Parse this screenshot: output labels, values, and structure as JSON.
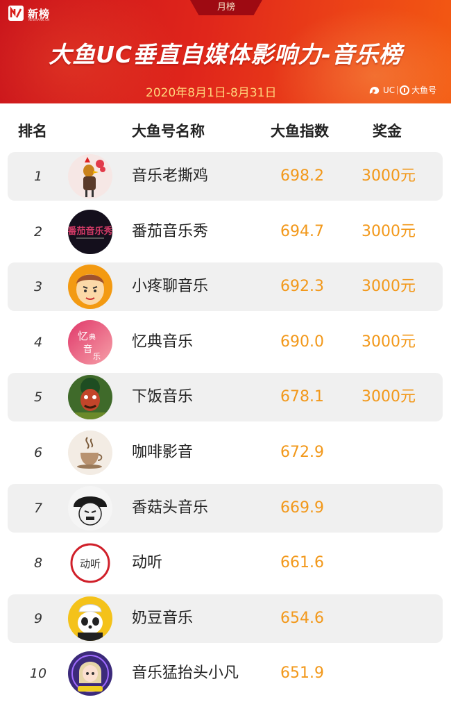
{
  "header": {
    "brand_name": "新榜",
    "brand_sub": "NEWRANK.CN",
    "month_tab": "月榜",
    "title": "大鱼UC垂直自媒体影响力-音乐榜",
    "date_range": "2020年8月1日-8月31日",
    "partner_uc": "UC",
    "partner_dayu": "大鱼号"
  },
  "columns": {
    "rank": "排名",
    "name": "大鱼号名称",
    "score": "大鱼指数",
    "prize": "奖金"
  },
  "rows": [
    {
      "rank": "1",
      "name": "音乐老撕鸡",
      "score": "698.2",
      "prize": "3000元",
      "avatar": "rooster-cartoon-avatar"
    },
    {
      "rank": "2",
      "name": "番茄音乐秀",
      "score": "694.7",
      "prize": "3000元",
      "avatar": "fanqie-music-show-logo-avatar"
    },
    {
      "rank": "3",
      "name": "小疼聊音乐",
      "score": "692.3",
      "prize": "3000元",
      "avatar": "cartoon-boy-avatar"
    },
    {
      "rank": "4",
      "name": "忆典音乐",
      "score": "690.0",
      "prize": "3000元",
      "avatar": "yidian-music-logo-avatar"
    },
    {
      "rank": "5",
      "name": "下饭音乐",
      "score": "678.1",
      "prize": "3000元",
      "avatar": "masked-figure-avatar"
    },
    {
      "rank": "6",
      "name": "咖啡影音",
      "score": "672.9",
      "prize": "",
      "avatar": "coffee-cup-avatar"
    },
    {
      "rank": "7",
      "name": "香菇头音乐",
      "score": "669.9",
      "prize": "",
      "avatar": "mushroom-head-meme-avatar"
    },
    {
      "rank": "8",
      "name": "动听",
      "score": "661.6",
      "prize": "",
      "avatar": "dongting-stamp-avatar"
    },
    {
      "rank": "9",
      "name": "奶豆音乐",
      "score": "654.6",
      "prize": "",
      "avatar": "panda-avatar"
    },
    {
      "rank": "10",
      "name": "音乐猛抬头小凡",
      "score": "651.9",
      "prize": "",
      "avatar": "cartoon-girl-avatar"
    }
  ],
  "colors": {
    "header_red": "#d81e1a",
    "accent_orange": "#f2981a",
    "row_shade": "#f0f0f0",
    "date_gold": "#ffd57c"
  }
}
